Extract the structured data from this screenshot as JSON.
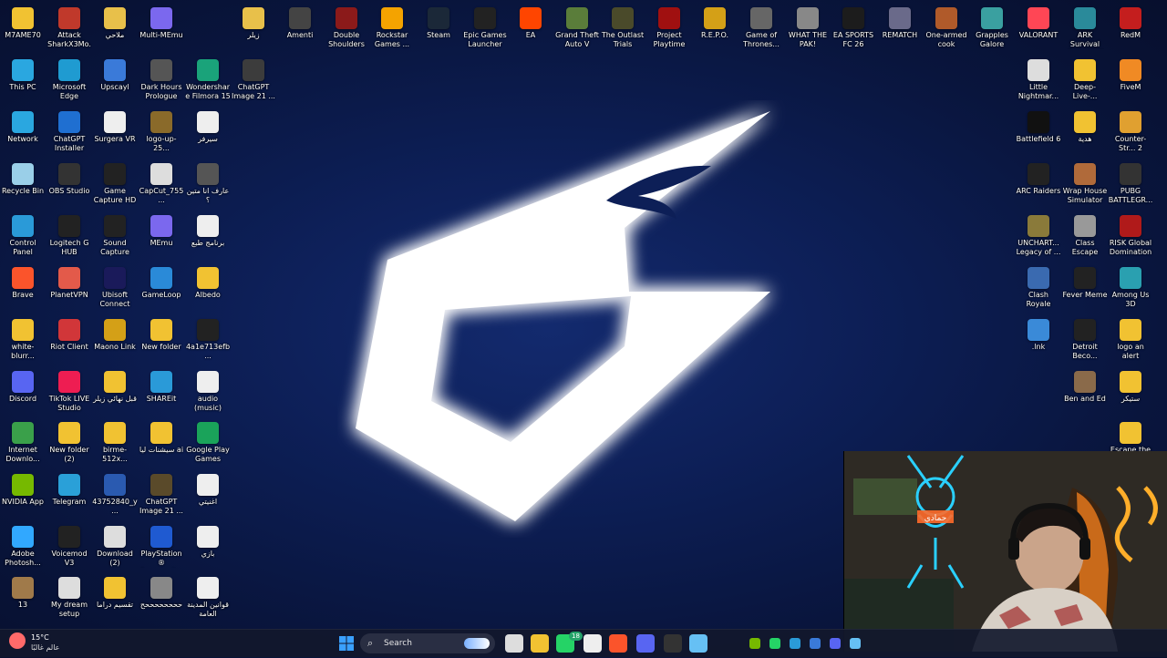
{
  "desktop_icons": [
    {
      "label": "M7AME70",
      "color": "#f1c232"
    },
    {
      "label": "Attack SharkX3Mo...",
      "color": "#c0392b"
    },
    {
      "label": "ملاحي",
      "color": "#e8c04a"
    },
    {
      "label": "Multi-MEmu",
      "color": "#7b68ee"
    },
    {
      "label": "زيلر",
      "color": "#e8c04a"
    },
    {
      "label": "Amenti",
      "color": "#444"
    },
    {
      "label": "Double Shoulders",
      "color": "#8b1a1a"
    },
    {
      "label": "Rockstar Games ...",
      "color": "#f4a300"
    },
    {
      "label": "Steam",
      "color": "#1b2838"
    },
    {
      "label": "Epic Games Launcher",
      "color": "#222"
    },
    {
      "label": "EA",
      "color": "#ff4500"
    },
    {
      "label": "Grand Theft Auto V",
      "color": "#5a7d3a"
    },
    {
      "label": "The Outlast Trials",
      "color": "#4a4a2a"
    },
    {
      "label": "Project Playtime",
      "color": "#a01010"
    },
    {
      "label": "R.E.P.O.",
      "color": "#d4a017"
    },
    {
      "label": "Game of Thrones...",
      "color": "#666"
    },
    {
      "label": "WHAT THE PAK!",
      "color": "#888"
    },
    {
      "label": "EA SPORTS FC 26",
      "color": "#1c1c1c"
    },
    {
      "label": "REMATCH",
      "color": "#6a6a8a"
    },
    {
      "label": "One-armed cook",
      "color": "#b05a2a"
    },
    {
      "label": "Grapples Galore",
      "color": "#3aa0a0"
    },
    {
      "label": "VALORANT",
      "color": "#ff4655"
    },
    {
      "label": "ARK Survival Ascended",
      "color": "#2a8a9a"
    },
    {
      "label": "RedM",
      "color": "#c41e1e"
    },
    {
      "label": "This PC",
      "color": "#2aa7e0"
    },
    {
      "label": "Microsoft Edge",
      "color": "#1f9bd1"
    },
    {
      "label": "Upscayl",
      "color": "#3a7ad9"
    },
    {
      "label": "Dark Hours Prologue",
      "color": "#555"
    },
    {
      "label": "Wondershare Filmora 15",
      "color": "#1aa37a"
    },
    {
      "label": "ChatGPT Image 21 ...",
      "color": "#3c3c3c"
    },
    {
      "label": "Little Nightmar...",
      "color": "#ddd"
    },
    {
      "label": "Deep-Live-...",
      "color": "#f1c232"
    },
    {
      "label": "FiveM",
      "color": "#f08a24"
    },
    {
      "label": "Network",
      "color": "#2aa7e0"
    },
    {
      "label": "ChatGPT Installer",
      "color": "#1f6fd1"
    },
    {
      "label": "Surgera VR",
      "color": "#eee"
    },
    {
      "label": "logo-up-25...",
      "color": "#8a6a2a"
    },
    {
      "label": "سيرفر",
      "color": "#eee"
    },
    {
      "label": "Battlefield 6",
      "color": "#111"
    },
    {
      "label": "هدية",
      "color": "#f1c232"
    },
    {
      "label": "Counter-Str... 2",
      "color": "#e0a030"
    },
    {
      "label": "Recycle Bin",
      "color": "#9acfe8"
    },
    {
      "label": "OBS Studio",
      "color": "#333"
    },
    {
      "label": "Game Capture HD",
      "color": "#222"
    },
    {
      "label": "CapCut_755...",
      "color": "#ddd"
    },
    {
      "label": "عارف انا متين ؟",
      "color": "#555"
    },
    {
      "label": "ARC Raiders",
      "color": "#222"
    },
    {
      "label": "Wrap House Simulator",
      "color": "#b06a3a"
    },
    {
      "label": "PUBG BATTLEGR...",
      "color": "#333"
    },
    {
      "label": "Control Panel",
      "color": "#2a9ad8"
    },
    {
      "label": "Logitech G HUB",
      "color": "#222"
    },
    {
      "label": "Sound Capture",
      "color": "#222"
    },
    {
      "label": "MEmu",
      "color": "#7b68ee"
    },
    {
      "label": "برنامج طبع",
      "color": "#eee"
    },
    {
      "label": "UNCHART... Legacy of ...",
      "color": "#8a7a3a"
    },
    {
      "label": "Class Escape",
      "color": "#999"
    },
    {
      "label": "RISK Global Domination",
      "color": "#b01a1a"
    },
    {
      "label": "Brave",
      "color": "#fb542b"
    },
    {
      "label": "PlanetVPN",
      "color": "#e35a4a"
    },
    {
      "label": "Ubisoft Connect",
      "color": "#1a1a5a"
    },
    {
      "label": "GameLoop",
      "color": "#2a8ad8"
    },
    {
      "label": "Albedo",
      "color": "#f1c232"
    },
    {
      "label": "Clash Royale",
      "color": "#3a6ab0"
    },
    {
      "label": "Fever Meme",
      "color": "#222"
    },
    {
      "label": "Among Us 3D",
      "color": "#2aa0b0"
    },
    {
      "label": "white-blurr...",
      "color": "#f1c232"
    },
    {
      "label": "Riot Client",
      "color": "#d13639"
    },
    {
      "label": "Maono Link",
      "color": "#d4a017"
    },
    {
      "label": "New folder",
      "color": "#f1c232"
    },
    {
      "label": "4a1e713efb...",
      "color": "#222"
    },
    {
      "label": ".lnk",
      "color": "#3a8ad8"
    },
    {
      "label": "Detroit Beco...",
      "color": "#222"
    },
    {
      "label": "logo an alert",
      "color": "#f1c232"
    },
    {
      "label": "Discord",
      "color": "#5865f2"
    },
    {
      "label": "TikTok LIVE Studio",
      "color": "#ee1d52"
    },
    {
      "label": "قبل نهائي زيلر",
      "color": "#f1c232"
    },
    {
      "label": "SHAREit",
      "color": "#2a9ad8"
    },
    {
      "label": "audio (music)",
      "color": "#eee"
    },
    {
      "label": "Ben and Ed",
      "color": "#8a6a4a"
    },
    {
      "label": "ستيكر",
      "color": "#f1c232"
    },
    {
      "label": "Internet Downlo...",
      "color": "#3aa04a"
    },
    {
      "label": "New folder (2)",
      "color": "#f1c232"
    },
    {
      "label": "birme-512x...",
      "color": "#f1c232"
    },
    {
      "label": "سيشنات ليا ai",
      "color": "#f1c232"
    },
    {
      "label": "Google Play Games",
      "color": "#1aa35a"
    },
    {
      "label": "Escape the Backrooms",
      "color": "#f1c232"
    },
    {
      "label": "NVIDIA App",
      "color": "#76b900"
    },
    {
      "label": "Telegram",
      "color": "#2aa0d8"
    },
    {
      "label": "43752840_y...",
      "color": "#2a5ab0"
    },
    {
      "label": "ChatGPT Image 21 ...",
      "color": "#5a4a2a"
    },
    {
      "label": "اغنيتي",
      "color": "#eee"
    },
    {
      "label": "Adobe Photosh...",
      "color": "#31a8ff"
    },
    {
      "label": "Voicemod V3",
      "color": "#222"
    },
    {
      "label": "Download (2)",
      "color": "#ddd"
    },
    {
      "label": "PlayStation® Accessories",
      "color": "#1f5ad1"
    },
    {
      "label": "بازي",
      "color": "#eee"
    },
    {
      "label": "13",
      "color": "#a07a4a"
    },
    {
      "label": "My dream setup",
      "color": "#ddd"
    },
    {
      "label": "تقسيم دراما",
      "color": "#f1c232"
    },
    {
      "label": "ححححححححح",
      "color": "#888"
    },
    {
      "label": "قوانين المدينة العامة",
      "color": "#eee"
    }
  ],
  "taskbar": {
    "weather_temp": "15°C",
    "weather_cond": "عالم غالبًا",
    "search_label": "Search",
    "chat_badge": "18",
    "apps": [
      {
        "name": "start",
        "color": "#3aa0ff"
      },
      {
        "name": "task-view",
        "color": "#ddd"
      },
      {
        "name": "file-explorer",
        "color": "#f1c232"
      },
      {
        "name": "whatsapp",
        "color": "#25d366"
      },
      {
        "name": "capcut",
        "color": "#eee"
      },
      {
        "name": "brave",
        "color": "#fb542b"
      },
      {
        "name": "discord",
        "color": "#5865f2"
      },
      {
        "name": "terminal",
        "color": "#333"
      },
      {
        "name": "steam",
        "color": "#66c0f4"
      }
    ],
    "tray": [
      {
        "name": "nvidia",
        "color": "#76b900"
      },
      {
        "name": "whatsapp",
        "color": "#25d366"
      },
      {
        "name": "shareit",
        "color": "#2a9ad8"
      },
      {
        "name": "upscayl",
        "color": "#3a7ad9"
      },
      {
        "name": "discord",
        "color": "#5865f2"
      },
      {
        "name": "steam",
        "color": "#66c0f4"
      }
    ]
  },
  "webcam": {
    "sign_text": "حمادي"
  },
  "colors": {
    "background": "#0d1f57",
    "logo": "#ffffff",
    "taskbar": "#12182c"
  }
}
